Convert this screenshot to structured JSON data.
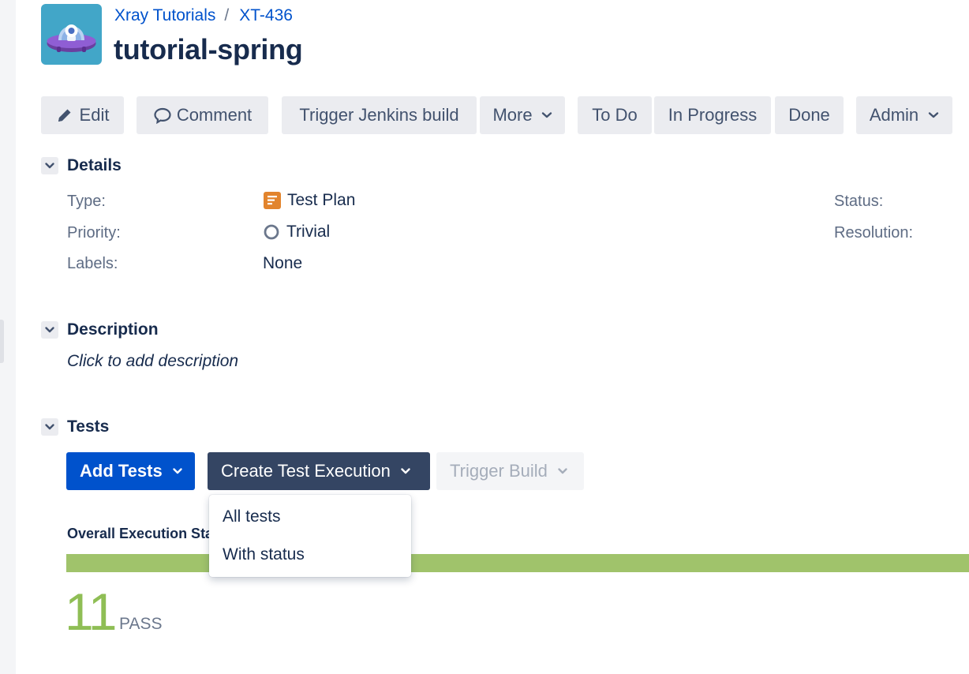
{
  "breadcrumb": {
    "project": "Xray Tutorials",
    "separator": "/",
    "issue_key": "XT-436"
  },
  "issue": {
    "title": "tutorial-spring"
  },
  "toolbar": {
    "edit": "Edit",
    "comment": "Comment",
    "trigger_jenkins": "Trigger Jenkins build",
    "more": "More",
    "todo": "To Do",
    "in_progress": "In Progress",
    "done": "Done",
    "admin": "Admin"
  },
  "details": {
    "heading": "Details",
    "type_label": "Type:",
    "type_value": "Test Plan",
    "priority_label": "Priority:",
    "priority_value": "Trivial",
    "labels_label": "Labels:",
    "labels_value": "None",
    "status_label": "Status:",
    "resolution_label": "Resolution:"
  },
  "description": {
    "heading": "Description",
    "placeholder": "Click to add description"
  },
  "tests": {
    "heading": "Tests",
    "add_tests": "Add Tests",
    "create_execution": "Create Test Execution",
    "trigger_build": "Trigger Build",
    "menu_items": [
      "All tests",
      "With status"
    ],
    "overall_label": "Overall Execution Status",
    "pass_count": "11",
    "pass_label": "PASS",
    "pass_fraction": 1.0
  },
  "colors": {
    "link": "#0052cc",
    "primary_button": "#0052cc",
    "dark_button": "#344563",
    "pass": "#8fbe55",
    "progress_fill": "#a0c36b",
    "test_plan_icon": "#e2842d"
  }
}
